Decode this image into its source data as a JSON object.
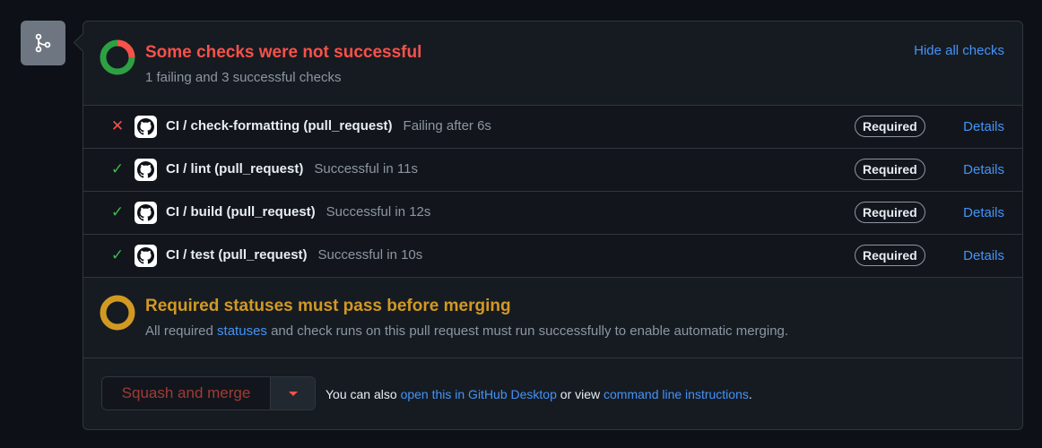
{
  "summary": {
    "title": "Some checks were not successful",
    "subtitle": "1 failing and 3 successful checks",
    "hide_link": "Hide all checks"
  },
  "checks": [
    {
      "name": "CI / check-formatting (pull_request)",
      "desc": "Failing after 6s",
      "status": "failing",
      "badge": "Required",
      "details": "Details"
    },
    {
      "name": "CI / lint (pull_request)",
      "desc": "Successful in 11s",
      "status": "success",
      "badge": "Required",
      "details": "Details"
    },
    {
      "name": "CI / build (pull_request)",
      "desc": "Successful in 12s",
      "status": "success",
      "badge": "Required",
      "details": "Details"
    },
    {
      "name": "CI / test (pull_request)",
      "desc": "Successful in 10s",
      "status": "success",
      "badge": "Required",
      "details": "Details"
    }
  ],
  "requirements": {
    "title": "Required statuses must pass before merging",
    "text_before": "All required ",
    "link": "statuses",
    "text_after": " and check runs on this pull request must run successfully to enable automatic merging."
  },
  "merge": {
    "button_label": "Squash and merge",
    "hint_before": "You can also ",
    "hint_link1": "open this in GitHub Desktop",
    "hint_middle": " or view ",
    "hint_link2": "command line instructions",
    "hint_after": "."
  },
  "colors": {
    "fail": "#f85149",
    "success": "#3fb950",
    "pending": "#d29922",
    "link": "#4493f8"
  }
}
